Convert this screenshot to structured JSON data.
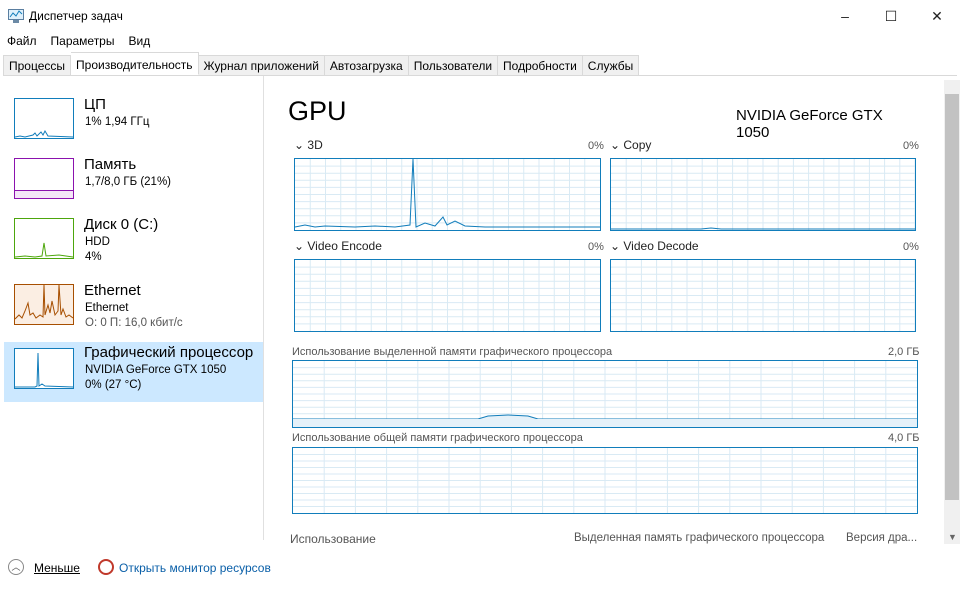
{
  "window": {
    "title": "Диспетчер задач",
    "minimize": "–",
    "maximize": "☐",
    "close": "✕"
  },
  "menu": [
    "Файл",
    "Параметры",
    "Вид"
  ],
  "tabs": [
    "Процессы",
    "Производительность",
    "Журнал приложений",
    "Автозагрузка",
    "Пользователи",
    "Подробности",
    "Службы"
  ],
  "sidebar": [
    {
      "name": "ЦП",
      "l1": "1% 1,94 ГГц"
    },
    {
      "name": "Память",
      "l1": "1,7/8,0 ГБ (21%)"
    },
    {
      "name": "Диск 0 (C:)",
      "l1": "HDD",
      "l2": "4%"
    },
    {
      "name": "Ethernet",
      "l1": "Ethernet",
      "l2": "О: 0 П: 16,0 кбит/с"
    },
    {
      "name": "Графический процессор",
      "l1": "NVIDIA GeForce GTX 1050",
      "l2": "0% (27 °C)"
    }
  ],
  "main": {
    "title": "GPU",
    "device": "NVIDIA GeForce GTX 1050",
    "engines": [
      {
        "label": "3D",
        "pct": "0%"
      },
      {
        "label": "Copy",
        "pct": "0%"
      },
      {
        "label": "Video Encode",
        "pct": "0%"
      },
      {
        "label": "Video Decode",
        "pct": "0%"
      }
    ],
    "dedicated_label": "Использование выделенной памяти графического процессора",
    "dedicated_max": "2,0 ГБ",
    "shared_label": "Использование общей памяти графического процессора",
    "shared_max": "4,0 ГБ",
    "stats": {
      "usage": "Использование",
      "dedicated": "Выделенная память графического процессора",
      "driver": "Версия дра..."
    }
  },
  "footer": {
    "less": "Меньше",
    "monitor": "Открыть монитор ресурсов"
  },
  "colors": {
    "gpu": "#117dbb",
    "cpu": "#117dbb",
    "memory": "#8b12ae",
    "disk": "#4da60c",
    "ethernet": "#a74f01",
    "selected": "#cce8ff"
  }
}
